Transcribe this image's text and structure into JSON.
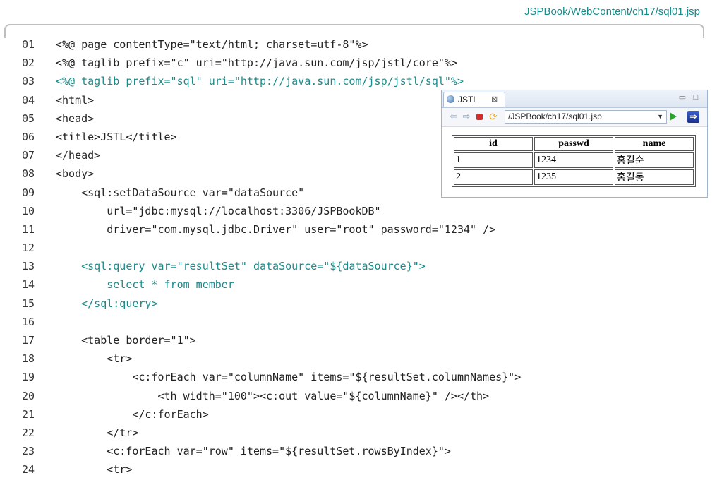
{
  "header": {
    "file_path": "JSPBook/WebContent/ch17/sql01.jsp"
  },
  "code": {
    "lines": [
      {
        "num": "01",
        "text": "<%@ page contentType=\"text/html; charset=utf-8\"%>"
      },
      {
        "num": "02",
        "text": "<%@ taglib prefix=\"c\" uri=\"http://java.sun.com/jsp/jstl/core\"%>"
      },
      {
        "num": "03",
        "text": "<%@ taglib prefix=\"sql\" uri=\"http://java.sun.com/jsp/jstl/sql\"%>"
      },
      {
        "num": "04",
        "text": "<html>"
      },
      {
        "num": "05",
        "text": "<head>"
      },
      {
        "num": "06",
        "text": "<title>JSTL</title>"
      },
      {
        "num": "07",
        "text": "</head>"
      },
      {
        "num": "08",
        "text": "<body>"
      },
      {
        "num": "09",
        "text": "    <sql:setDataSource var=\"dataSource\""
      },
      {
        "num": "10",
        "text": "        url=\"jdbc:mysql://localhost:3306/JSPBookDB\""
      },
      {
        "num": "11",
        "text": "        driver=\"com.mysql.jdbc.Driver\" user=\"root\" password=\"1234\" />"
      },
      {
        "num": "12",
        "text": ""
      },
      {
        "num": "13",
        "text": "    <sql:query var=\"resultSet\" dataSource=\"${dataSource}\">"
      },
      {
        "num": "14",
        "text": "        select * from member"
      },
      {
        "num": "15",
        "text": "    </sql:query>"
      },
      {
        "num": "16",
        "text": ""
      },
      {
        "num": "17",
        "text": "    <table border=\"1\">"
      },
      {
        "num": "18",
        "text": "        <tr>"
      },
      {
        "num": "19",
        "text": "            <c:forEach var=\"columnName\" items=\"${resultSet.columnNames}\">"
      },
      {
        "num": "20",
        "text": "                <th width=\"100\"><c:out value=\"${columnName}\" /></th>"
      },
      {
        "num": "21",
        "text": "            </c:forEach>"
      },
      {
        "num": "22",
        "text": "        </tr>"
      },
      {
        "num": "23",
        "text": "        <c:forEach var=\"row\" items=\"${resultSet.rowsByIndex}\">"
      },
      {
        "num": "24",
        "text": "        <tr>"
      }
    ],
    "teal_lines": [
      "03",
      "13",
      "14",
      "15"
    ]
  },
  "browser": {
    "tab_label": "JSTL",
    "tab_close": "⊠",
    "minimize": "▭",
    "maximize": "□",
    "url": "/JSPBook/ch17/sql01.jsp",
    "table": {
      "headers": [
        "id",
        "passwd",
        "name"
      ],
      "rows": [
        [
          "1",
          "1234",
          "홍길순"
        ],
        [
          "2",
          "1235",
          "홍길동"
        ]
      ]
    }
  },
  "colors": {
    "teal": "#1a8a8a",
    "text": "#222222"
  }
}
